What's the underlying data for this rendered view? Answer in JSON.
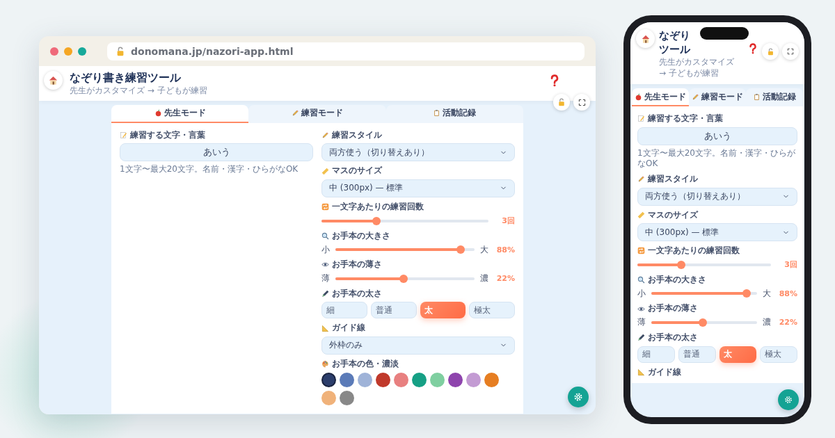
{
  "browser": {
    "url": "donomana.jp/nazori-app.html"
  },
  "app": {
    "title": "なぞり書き練習ツール",
    "subtitle": "先生がカスタマイズ → 子どもが練習"
  },
  "tabs": [
    {
      "label": "先生モード",
      "selected": true
    },
    {
      "label": "練習モード",
      "selected": false
    },
    {
      "label": "活動記録",
      "selected": false
    }
  ],
  "word": {
    "label": "練習する文字・言葉",
    "value": "あいう",
    "hint": "1文字〜最大20文字。名前・漢字・ひらがなOK"
  },
  "fields": [
    {
      "kind": "select",
      "label": "練習スタイル",
      "value": "両方使う（切り替えあり）"
    },
    {
      "kind": "select",
      "label": "マスのサイズ",
      "value": "中 (300px) — 標準"
    },
    {
      "kind": "slider",
      "label": "一文字あたりの練習回数",
      "level": 0.33,
      "reading": "3回"
    },
    {
      "kind": "slider",
      "label": "お手本の大きさ",
      "min": "小",
      "max": "大",
      "level": 0.9,
      "reading": "88%"
    },
    {
      "kind": "slider",
      "label": "お手本の薄さ",
      "min": "薄",
      "max": "濃",
      "level": 0.49,
      "reading": "22%"
    },
    {
      "kind": "segmented",
      "label": "お手本の太さ",
      "options": [
        {
          "label": "細",
          "selected": false
        },
        {
          "label": "普通",
          "selected": false
        },
        {
          "label": "太",
          "selected": true
        },
        {
          "label": "極太",
          "selected": false
        }
      ]
    },
    {
      "kind": "select",
      "label": "ガイド線",
      "value": "外枠のみ"
    },
    {
      "kind": "swatches",
      "label": "お手本の色・濃淡",
      "swatches": [
        {
          "color": "#2c3e6b",
          "selected": true
        },
        {
          "color": "#5b7bb8",
          "selected": false
        },
        {
          "color": "#9fb3d8",
          "selected": false
        },
        {
          "color": "#c0392b",
          "selected": false
        },
        {
          "color": "#e88080",
          "selected": false
        },
        {
          "color": "#16a085",
          "selected": false
        },
        {
          "color": "#7fcfa0",
          "selected": false
        },
        {
          "color": "#8e44ad",
          "selected": false
        },
        {
          "color": "#c39bd3",
          "selected": false
        },
        {
          "color": "#e67e22",
          "selected": false
        },
        {
          "color": "#f0b27a",
          "selected": false
        },
        {
          "color": "#888888",
          "selected": false
        }
      ]
    }
  ],
  "phone": {
    "title_lines": [
      "なぞり",
      "ツール"
    ],
    "subtitle": "先生がカスタマイズ → 子どもが練習",
    "tabs": [
      {
        "label": "先生モード",
        "selected": true
      },
      {
        "label": "練習モード",
        "selected": false
      },
      {
        "label": "活動記録",
        "selected": false
      }
    ],
    "word": {
      "label": "練習する文字・言葉",
      "value": "あいう",
      "hint": "1文字〜最大20文字。名前・漢字・ひらがなOK"
    },
    "fields": [
      {
        "kind": "select",
        "label": "練習スタイル",
        "value": "両方使う（切り替えあり）"
      },
      {
        "kind": "select",
        "label": "マスのサイズ",
        "value": "中 (300px) — 標準"
      },
      {
        "kind": "slider",
        "label": "一文字あたりの練習回数",
        "level": 0.33,
        "reading": "3回"
      },
      {
        "kind": "slider",
        "label": "お手本の大きさ",
        "min": "小",
        "max": "大",
        "level": 0.9,
        "reading": "88%"
      },
      {
        "kind": "slider",
        "label": "お手本の薄さ",
        "min": "薄",
        "max": "濃",
        "level": 0.49,
        "reading": "22%"
      },
      {
        "kind": "segmented",
        "label": "お手本の太さ",
        "options": [
          {
            "label": "細",
            "selected": false
          },
          {
            "label": "普通",
            "selected": false
          },
          {
            "label": "太",
            "selected": true
          },
          {
            "label": "極太",
            "selected": false
          }
        ]
      },
      {
        "kind": "heading",
        "label": "ガイド線"
      }
    ]
  }
}
